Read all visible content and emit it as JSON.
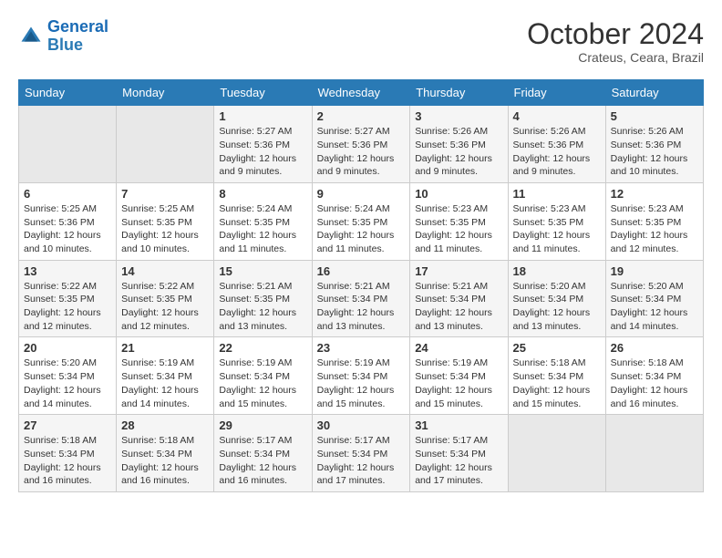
{
  "header": {
    "logo_line1": "General",
    "logo_line2": "Blue",
    "month": "October 2024",
    "location": "Crateus, Ceara, Brazil"
  },
  "days_of_week": [
    "Sunday",
    "Monday",
    "Tuesday",
    "Wednesday",
    "Thursday",
    "Friday",
    "Saturday"
  ],
  "weeks": [
    [
      {
        "day": "",
        "info": ""
      },
      {
        "day": "",
        "info": ""
      },
      {
        "day": "1",
        "info": "Sunrise: 5:27 AM\nSunset: 5:36 PM\nDaylight: 12 hours and 9 minutes."
      },
      {
        "day": "2",
        "info": "Sunrise: 5:27 AM\nSunset: 5:36 PM\nDaylight: 12 hours and 9 minutes."
      },
      {
        "day": "3",
        "info": "Sunrise: 5:26 AM\nSunset: 5:36 PM\nDaylight: 12 hours and 9 minutes."
      },
      {
        "day": "4",
        "info": "Sunrise: 5:26 AM\nSunset: 5:36 PM\nDaylight: 12 hours and 9 minutes."
      },
      {
        "day": "5",
        "info": "Sunrise: 5:26 AM\nSunset: 5:36 PM\nDaylight: 12 hours and 10 minutes."
      }
    ],
    [
      {
        "day": "6",
        "info": "Sunrise: 5:25 AM\nSunset: 5:36 PM\nDaylight: 12 hours and 10 minutes."
      },
      {
        "day": "7",
        "info": "Sunrise: 5:25 AM\nSunset: 5:35 PM\nDaylight: 12 hours and 10 minutes."
      },
      {
        "day": "8",
        "info": "Sunrise: 5:24 AM\nSunset: 5:35 PM\nDaylight: 12 hours and 11 minutes."
      },
      {
        "day": "9",
        "info": "Sunrise: 5:24 AM\nSunset: 5:35 PM\nDaylight: 12 hours and 11 minutes."
      },
      {
        "day": "10",
        "info": "Sunrise: 5:23 AM\nSunset: 5:35 PM\nDaylight: 12 hours and 11 minutes."
      },
      {
        "day": "11",
        "info": "Sunrise: 5:23 AM\nSunset: 5:35 PM\nDaylight: 12 hours and 11 minutes."
      },
      {
        "day": "12",
        "info": "Sunrise: 5:23 AM\nSunset: 5:35 PM\nDaylight: 12 hours and 12 minutes."
      }
    ],
    [
      {
        "day": "13",
        "info": "Sunrise: 5:22 AM\nSunset: 5:35 PM\nDaylight: 12 hours and 12 minutes."
      },
      {
        "day": "14",
        "info": "Sunrise: 5:22 AM\nSunset: 5:35 PM\nDaylight: 12 hours and 12 minutes."
      },
      {
        "day": "15",
        "info": "Sunrise: 5:21 AM\nSunset: 5:35 PM\nDaylight: 12 hours and 13 minutes."
      },
      {
        "day": "16",
        "info": "Sunrise: 5:21 AM\nSunset: 5:34 PM\nDaylight: 12 hours and 13 minutes."
      },
      {
        "day": "17",
        "info": "Sunrise: 5:21 AM\nSunset: 5:34 PM\nDaylight: 12 hours and 13 minutes."
      },
      {
        "day": "18",
        "info": "Sunrise: 5:20 AM\nSunset: 5:34 PM\nDaylight: 12 hours and 13 minutes."
      },
      {
        "day": "19",
        "info": "Sunrise: 5:20 AM\nSunset: 5:34 PM\nDaylight: 12 hours and 14 minutes."
      }
    ],
    [
      {
        "day": "20",
        "info": "Sunrise: 5:20 AM\nSunset: 5:34 PM\nDaylight: 12 hours and 14 minutes."
      },
      {
        "day": "21",
        "info": "Sunrise: 5:19 AM\nSunset: 5:34 PM\nDaylight: 12 hours and 14 minutes."
      },
      {
        "day": "22",
        "info": "Sunrise: 5:19 AM\nSunset: 5:34 PM\nDaylight: 12 hours and 15 minutes."
      },
      {
        "day": "23",
        "info": "Sunrise: 5:19 AM\nSunset: 5:34 PM\nDaylight: 12 hours and 15 minutes."
      },
      {
        "day": "24",
        "info": "Sunrise: 5:19 AM\nSunset: 5:34 PM\nDaylight: 12 hours and 15 minutes."
      },
      {
        "day": "25",
        "info": "Sunrise: 5:18 AM\nSunset: 5:34 PM\nDaylight: 12 hours and 15 minutes."
      },
      {
        "day": "26",
        "info": "Sunrise: 5:18 AM\nSunset: 5:34 PM\nDaylight: 12 hours and 16 minutes."
      }
    ],
    [
      {
        "day": "27",
        "info": "Sunrise: 5:18 AM\nSunset: 5:34 PM\nDaylight: 12 hours and 16 minutes."
      },
      {
        "day": "28",
        "info": "Sunrise: 5:18 AM\nSunset: 5:34 PM\nDaylight: 12 hours and 16 minutes."
      },
      {
        "day": "29",
        "info": "Sunrise: 5:17 AM\nSunset: 5:34 PM\nDaylight: 12 hours and 16 minutes."
      },
      {
        "day": "30",
        "info": "Sunrise: 5:17 AM\nSunset: 5:34 PM\nDaylight: 12 hours and 17 minutes."
      },
      {
        "day": "31",
        "info": "Sunrise: 5:17 AM\nSunset: 5:34 PM\nDaylight: 12 hours and 17 minutes."
      },
      {
        "day": "",
        "info": ""
      },
      {
        "day": "",
        "info": ""
      }
    ]
  ]
}
